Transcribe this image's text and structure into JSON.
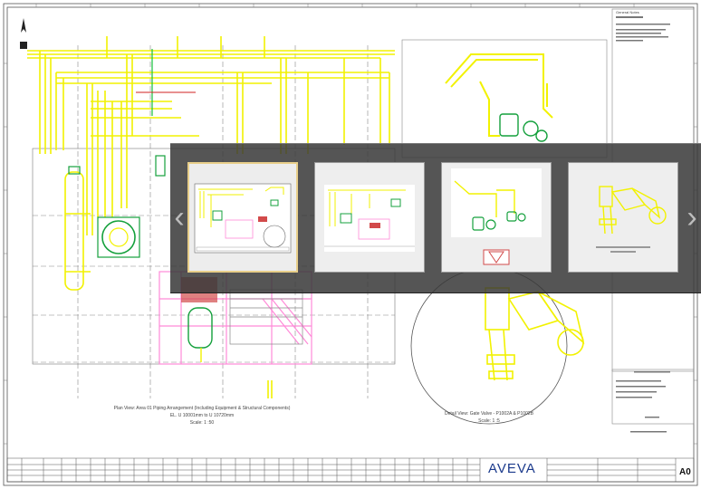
{
  "drawing": {
    "plan_view_caption": "Plan View: Area 01 Piping Arrangement (Including Equipment & Structural Components)",
    "plan_view_elevation": "EL. U 10001mm to U 10720mm",
    "plan_view_scale": "Scale: 1 :50",
    "detail_view_caption": "Detail View: Gate Valve - P1002A & P1002B",
    "detail_view_scale": "Scale: 1 :5",
    "general_notes_title": "General Notes",
    "sheet_size": "A0",
    "logo_text": "AVEVA"
  },
  "gallery": {
    "prev_label": "‹",
    "next_label": "›",
    "thumbnails": [
      {
        "name": "thumb-full-sheet",
        "active": true
      },
      {
        "name": "thumb-plan-view",
        "active": false
      },
      {
        "name": "thumb-isometric-view",
        "active": false
      },
      {
        "name": "thumb-detail-view",
        "active": false
      }
    ]
  },
  "colors": {
    "pipe_yellow": "#f2f200",
    "pipe_magenta": "#ff8ad8",
    "equipment_green": "#14a03c",
    "line_grey": "#8a8a8a",
    "overlay_bg": "#3a3a3a",
    "active_border": "#e8cf8a",
    "logo_blue": "#1b3a8c"
  }
}
